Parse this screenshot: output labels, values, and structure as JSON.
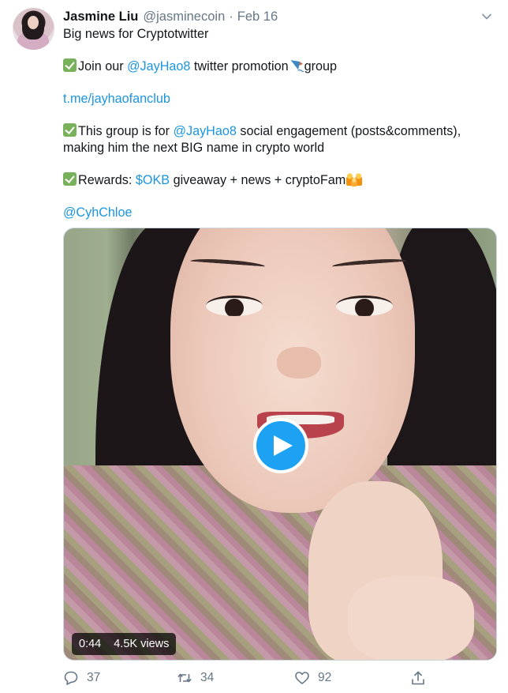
{
  "tweet": {
    "author_name": "Jasmine Liu",
    "author_handle": "@jasminecoin",
    "separator": "·",
    "date": "Feb 16",
    "menu_icon": "chevron-down-icon",
    "body": {
      "line1": "Big news for Cryptotwitter",
      "line2_pre": "Join our ",
      "line2_mention": "@JayHao8",
      "line2_post": " twitter promotion",
      "line2_end": "group",
      "line3_link": "t.me/jayhaofanclub",
      "line4_pre": "This group is for ",
      "line4_mention": "@JayHao8",
      "line4_post": " social engagement (posts&comments),",
      "line5": "making him the next BIG name in crypto world",
      "line6_pre": "Rewards: ",
      "line6_cashtag": "$OKB",
      "line6_post": " giveaway + news + cryptoFam",
      "line7_mention": "@CyhChloe"
    },
    "emoji": {
      "check": "white-heavy-check-mark",
      "kite": "kite",
      "family": "family"
    },
    "media": {
      "type": "video",
      "duration": "0:44",
      "views": "4.5K views"
    },
    "actions": {
      "replies": "37",
      "retweets": "34",
      "likes": "92"
    },
    "colors": {
      "link": "#1b95e0",
      "secondary_text": "#657786",
      "play_button": "#1da1f2",
      "check_emoji": "#78b159"
    }
  }
}
